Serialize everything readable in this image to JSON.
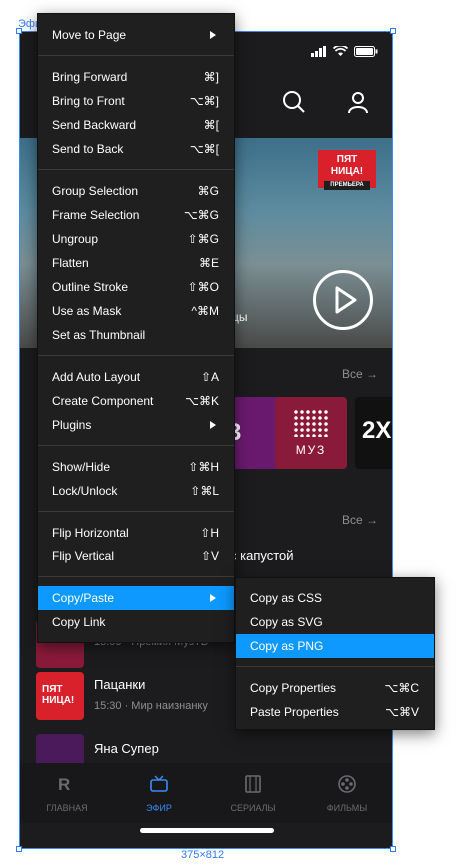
{
  "canvas": {
    "frame_label": "Эфир",
    "frame_size": "375×812"
  },
  "app": {
    "hero": {
      "badge_line1": "ПЯТ",
      "badge_line2": "НИЦА!",
      "badge_tag": "ПРЕМЬЕРА",
      "title_fragment": "цы"
    },
    "sections": {
      "all_label": "Все →"
    },
    "tiles": [
      {
        "label": "3",
        "color": "#6a1a6e"
      },
      {
        "label": "МУЗ",
        "color": "#8a1a3a"
      },
      {
        "label": "2X",
        "color": "#111111"
      }
    ],
    "list": [
      {
        "title": "с капустой",
        "subtitle": ""
      },
      {
        "title": "",
        "subtitle": "15:00 · Премия МузТВ"
      },
      {
        "title": "Пацанки",
        "subtitle": "15:30 · Мир наизнанку"
      },
      {
        "title": "Яна Супер",
        "subtitle": ""
      }
    ],
    "nav": [
      {
        "label": "ГЛАВНАЯ",
        "icon": "r-logo-icon"
      },
      {
        "label": "ЭФИР",
        "icon": "tv-icon"
      },
      {
        "label": "СЕРИАЛЫ",
        "icon": "film-icon"
      },
      {
        "label": "ФИЛЬМЫ",
        "icon": "reel-icon"
      }
    ],
    "colors": {
      "accent": "#0d99ff",
      "nav_active": "#3b8bf5",
      "background": "#1c1c1e"
    }
  },
  "context_menu": {
    "items": [
      {
        "label": "Move to Page",
        "shortcut": "",
        "submenu": true
      },
      {
        "label": "Bring Forward",
        "shortcut": "⌘]"
      },
      {
        "label": "Bring to Front",
        "shortcut": "⌥⌘]"
      },
      {
        "label": "Send Backward",
        "shortcut": "⌘["
      },
      {
        "label": "Send to Back",
        "shortcut": "⌥⌘["
      },
      {
        "label": "Group Selection",
        "shortcut": "⌘G"
      },
      {
        "label": "Frame Selection",
        "shortcut": "⌥⌘G"
      },
      {
        "label": "Ungroup",
        "shortcut": "⇧⌘G"
      },
      {
        "label": "Flatten",
        "shortcut": "⌘E"
      },
      {
        "label": "Outline Stroke",
        "shortcut": "⇧⌘O"
      },
      {
        "label": "Use as Mask",
        "shortcut": "^⌘M"
      },
      {
        "label": "Set as Thumbnail",
        "shortcut": ""
      },
      {
        "label": "Add Auto Layout",
        "shortcut": "⇧A"
      },
      {
        "label": "Create Component",
        "shortcut": "⌥⌘K"
      },
      {
        "label": "Plugins",
        "shortcut": "",
        "submenu": true
      },
      {
        "label": "Show/Hide",
        "shortcut": "⇧⌘H"
      },
      {
        "label": "Lock/Unlock",
        "shortcut": "⇧⌘L"
      },
      {
        "label": "Flip Horizontal",
        "shortcut": "⇧H"
      },
      {
        "label": "Flip Vertical",
        "shortcut": "⇧V"
      },
      {
        "label": "Copy/Paste",
        "shortcut": "",
        "submenu": true,
        "highlighted": true
      },
      {
        "label": "Copy Link",
        "shortcut": ""
      }
    ]
  },
  "submenu": {
    "items": [
      {
        "label": "Copy as CSS",
        "shortcut": ""
      },
      {
        "label": "Copy as SVG",
        "shortcut": ""
      },
      {
        "label": "Copy as PNG",
        "shortcut": "",
        "highlighted": true
      },
      {
        "label": "Copy Properties",
        "shortcut": "⌥⌘C"
      },
      {
        "label": "Paste Properties",
        "shortcut": "⌥⌘V"
      }
    ]
  }
}
